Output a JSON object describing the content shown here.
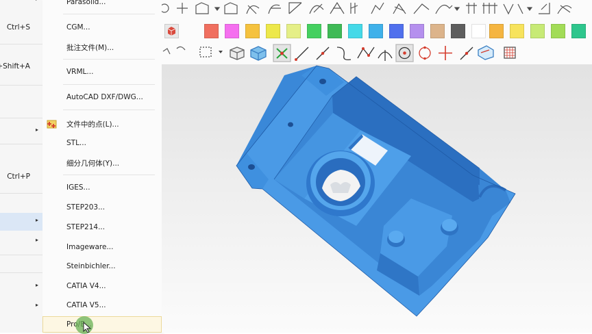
{
  "parent_menu": {
    "items": [
      {
        "shortcut": "Ctrl+S",
        "arrow": ""
      },
      {
        "shortcut": "+Shift+A",
        "arrow": ""
      },
      {
        "shortcut": "",
        "arrow": "▸"
      },
      {
        "shortcut": "Ctrl+P",
        "arrow": ""
      },
      {
        "shortcut": "",
        "arrow": "▸"
      },
      {
        "shortcut": "",
        "arrow": "▸"
      },
      {
        "shortcut": "",
        "arrow": "▸"
      },
      {
        "shortcut": "",
        "arrow": "▸"
      },
      {
        "shortcut": "",
        "arrow": "▸"
      }
    ]
  },
  "submenu": {
    "items": [
      {
        "label": "Parasolid...",
        "mnemonic": "a"
      },
      {
        "label": "CGM...",
        "mnemonic": "C"
      },
      {
        "label": "批注文件(M)...",
        "mnemonic": "M"
      },
      {
        "label": "VRML...",
        "mnemonic": "V"
      },
      {
        "label": "AutoCAD DXF/DWG...",
        "mnemonic": "D"
      },
      {
        "label": "文件中的点(L)...",
        "mnemonic": "L"
      },
      {
        "label": "STL...",
        "mnemonic": "S"
      },
      {
        "label": "细分几何体(Y)...",
        "mnemonic": "Y"
      },
      {
        "label": "IGES...",
        "mnemonic": "I"
      },
      {
        "label": "STEP203...",
        "mnemonic": "2"
      },
      {
        "label": "STEP214...",
        "mnemonic": "1"
      },
      {
        "label": "Imageware...",
        "mnemonic": "I"
      },
      {
        "label": "Steinbichler...",
        "mnemonic": "b"
      },
      {
        "label": "CATIA V4...",
        "mnemonic": "4"
      },
      {
        "label": "CATIA V5...",
        "mnemonic": "5"
      },
      {
        "label": "Pro/E...",
        "mnemonic": "E"
      }
    ]
  },
  "toolbar": {
    "color_swatches": [
      "#d94a3d",
      "#f06f5f",
      "#f56fef",
      "#f5c23e",
      "#ede84a",
      "#e5ef87",
      "#45d060",
      "#3fba56",
      "#45d9e8",
      "#3fb1ea",
      "#5070ed",
      "#b590ee",
      "#dcb48b",
      "#5e5e5e",
      "#ffffff",
      "#f5b540",
      "#f7e35c",
      "#c7ea76",
      "#a2dc57",
      "#2ec68d"
    ],
    "icons_row1": [
      "point-icon",
      "plus-icon",
      "sketch-shape-icon",
      "arrow-dropdown-icon",
      "surface-icon",
      "curve-icon",
      "curve-icon",
      "curve-icon",
      "curve-icon",
      "curve-icon",
      "dimension-icon",
      "arrow-dropdown-icon",
      "dimension-icon",
      "dimension-icon",
      "dimension-icon",
      "arrow-dropdown-icon",
      "dimension-icon",
      "dimension-icon"
    ],
    "icons_row3": [
      "rotate-icon",
      "select-box-icon",
      "dropdown-icon",
      "shaded-box-icon",
      "cube-icon",
      "snap-grid-icon",
      "line-icon",
      "line-red-icon",
      "curve-tangent-icon",
      "spline-icon",
      "arc-icon",
      "circle-center-icon",
      "circle-icon",
      "cross-icon",
      "diagonal-icon",
      "view-icon",
      "grid-icon"
    ]
  },
  "viewport": {
    "model_color": "#3d8fe0",
    "background": "gradient-light-gray"
  }
}
